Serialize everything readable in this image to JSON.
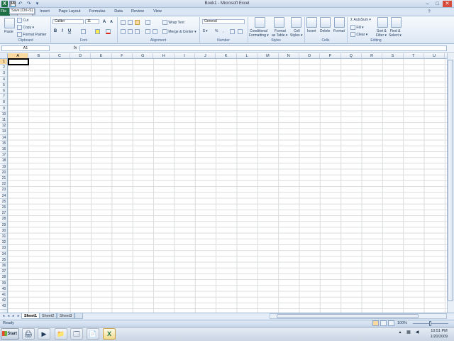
{
  "window": {
    "title": "Book1 - Microsoft Excel",
    "app_icon": "X",
    "controls": [
      "–",
      "□",
      "✕"
    ]
  },
  "quick_access": {
    "save": "💾",
    "undo": "↶",
    "redo": "↷",
    "customize": "▾"
  },
  "tooltip": "Save (Ctrl+S)",
  "tabs": [
    "File",
    "Home",
    "Insert",
    "Page Layout",
    "Formulas",
    "Data",
    "Review",
    "View"
  ],
  "ribbon": {
    "clipboard": {
      "paste": "Paste",
      "cut": "Cut",
      "copy": "Copy ▾",
      "format_painter": "Format Painter",
      "label": "Clipboard"
    },
    "font": {
      "name": "Calibri",
      "size": "11",
      "grow": "A",
      "shrink": "A",
      "bold": "B",
      "italic": "I",
      "underline": "U",
      "label": "Font"
    },
    "alignment": {
      "wrap": "Wrap Text",
      "merge": "Merge & Center ▾",
      "label": "Alignment"
    },
    "number": {
      "format": "General",
      "currency": "$ ▾",
      "percent": "%",
      "comma": ",",
      "label": "Number"
    },
    "styles": {
      "conditional": "Conditional",
      "conditional2": "Formatting ▾",
      "table": "Format",
      "table2": "as Table ▾",
      "cell": "Cell",
      "cell2": "Styles ▾",
      "label": "Styles"
    },
    "cells": {
      "insert": "Insert",
      "delete": "Delete",
      "format": "Format",
      "label": "Cells"
    },
    "editing": {
      "autosum": "Σ AutoSum ▾",
      "fill": "Fill ▾",
      "clear": "Clear ▾",
      "sort": "Sort &",
      "sort2": "Filter ▾",
      "find": "Find &",
      "find2": "Select ▾",
      "label": "Editing"
    }
  },
  "formula_bar": {
    "name_box": "A1",
    "fx": "fx",
    "value": ""
  },
  "grid": {
    "columns": [
      "A",
      "B",
      "C",
      "D",
      "E",
      "F",
      "G",
      "H",
      "I",
      "J",
      "K",
      "L",
      "M",
      "N",
      "O",
      "P",
      "Q",
      "R",
      "S",
      "T",
      "U"
    ],
    "rows": [
      "1",
      "2",
      "3",
      "4",
      "5",
      "6",
      "7",
      "8",
      "9",
      "10",
      "11",
      "12",
      "13",
      "14",
      "15",
      "16",
      "17",
      "18",
      "19",
      "20",
      "21",
      "22",
      "23",
      "24",
      "25",
      "26",
      "27",
      "28",
      "29",
      "30",
      "31",
      "32",
      "33",
      "34",
      "35",
      "36",
      "37",
      "38",
      "39",
      "40",
      "41",
      "42",
      "43"
    ],
    "active_column": "A",
    "active_row": "1"
  },
  "sheets": [
    "Sheet1",
    "Sheet2",
    "Sheet3"
  ],
  "active_sheet": "Sheet1",
  "status": {
    "text": "Ready",
    "zoom": "100%"
  },
  "taskbar": {
    "start": "Start",
    "items": [
      "🖨",
      "▶",
      "📁",
      "🗔",
      "📄",
      "X"
    ],
    "time": "10:51 PM",
    "date": "1/20/2009"
  }
}
